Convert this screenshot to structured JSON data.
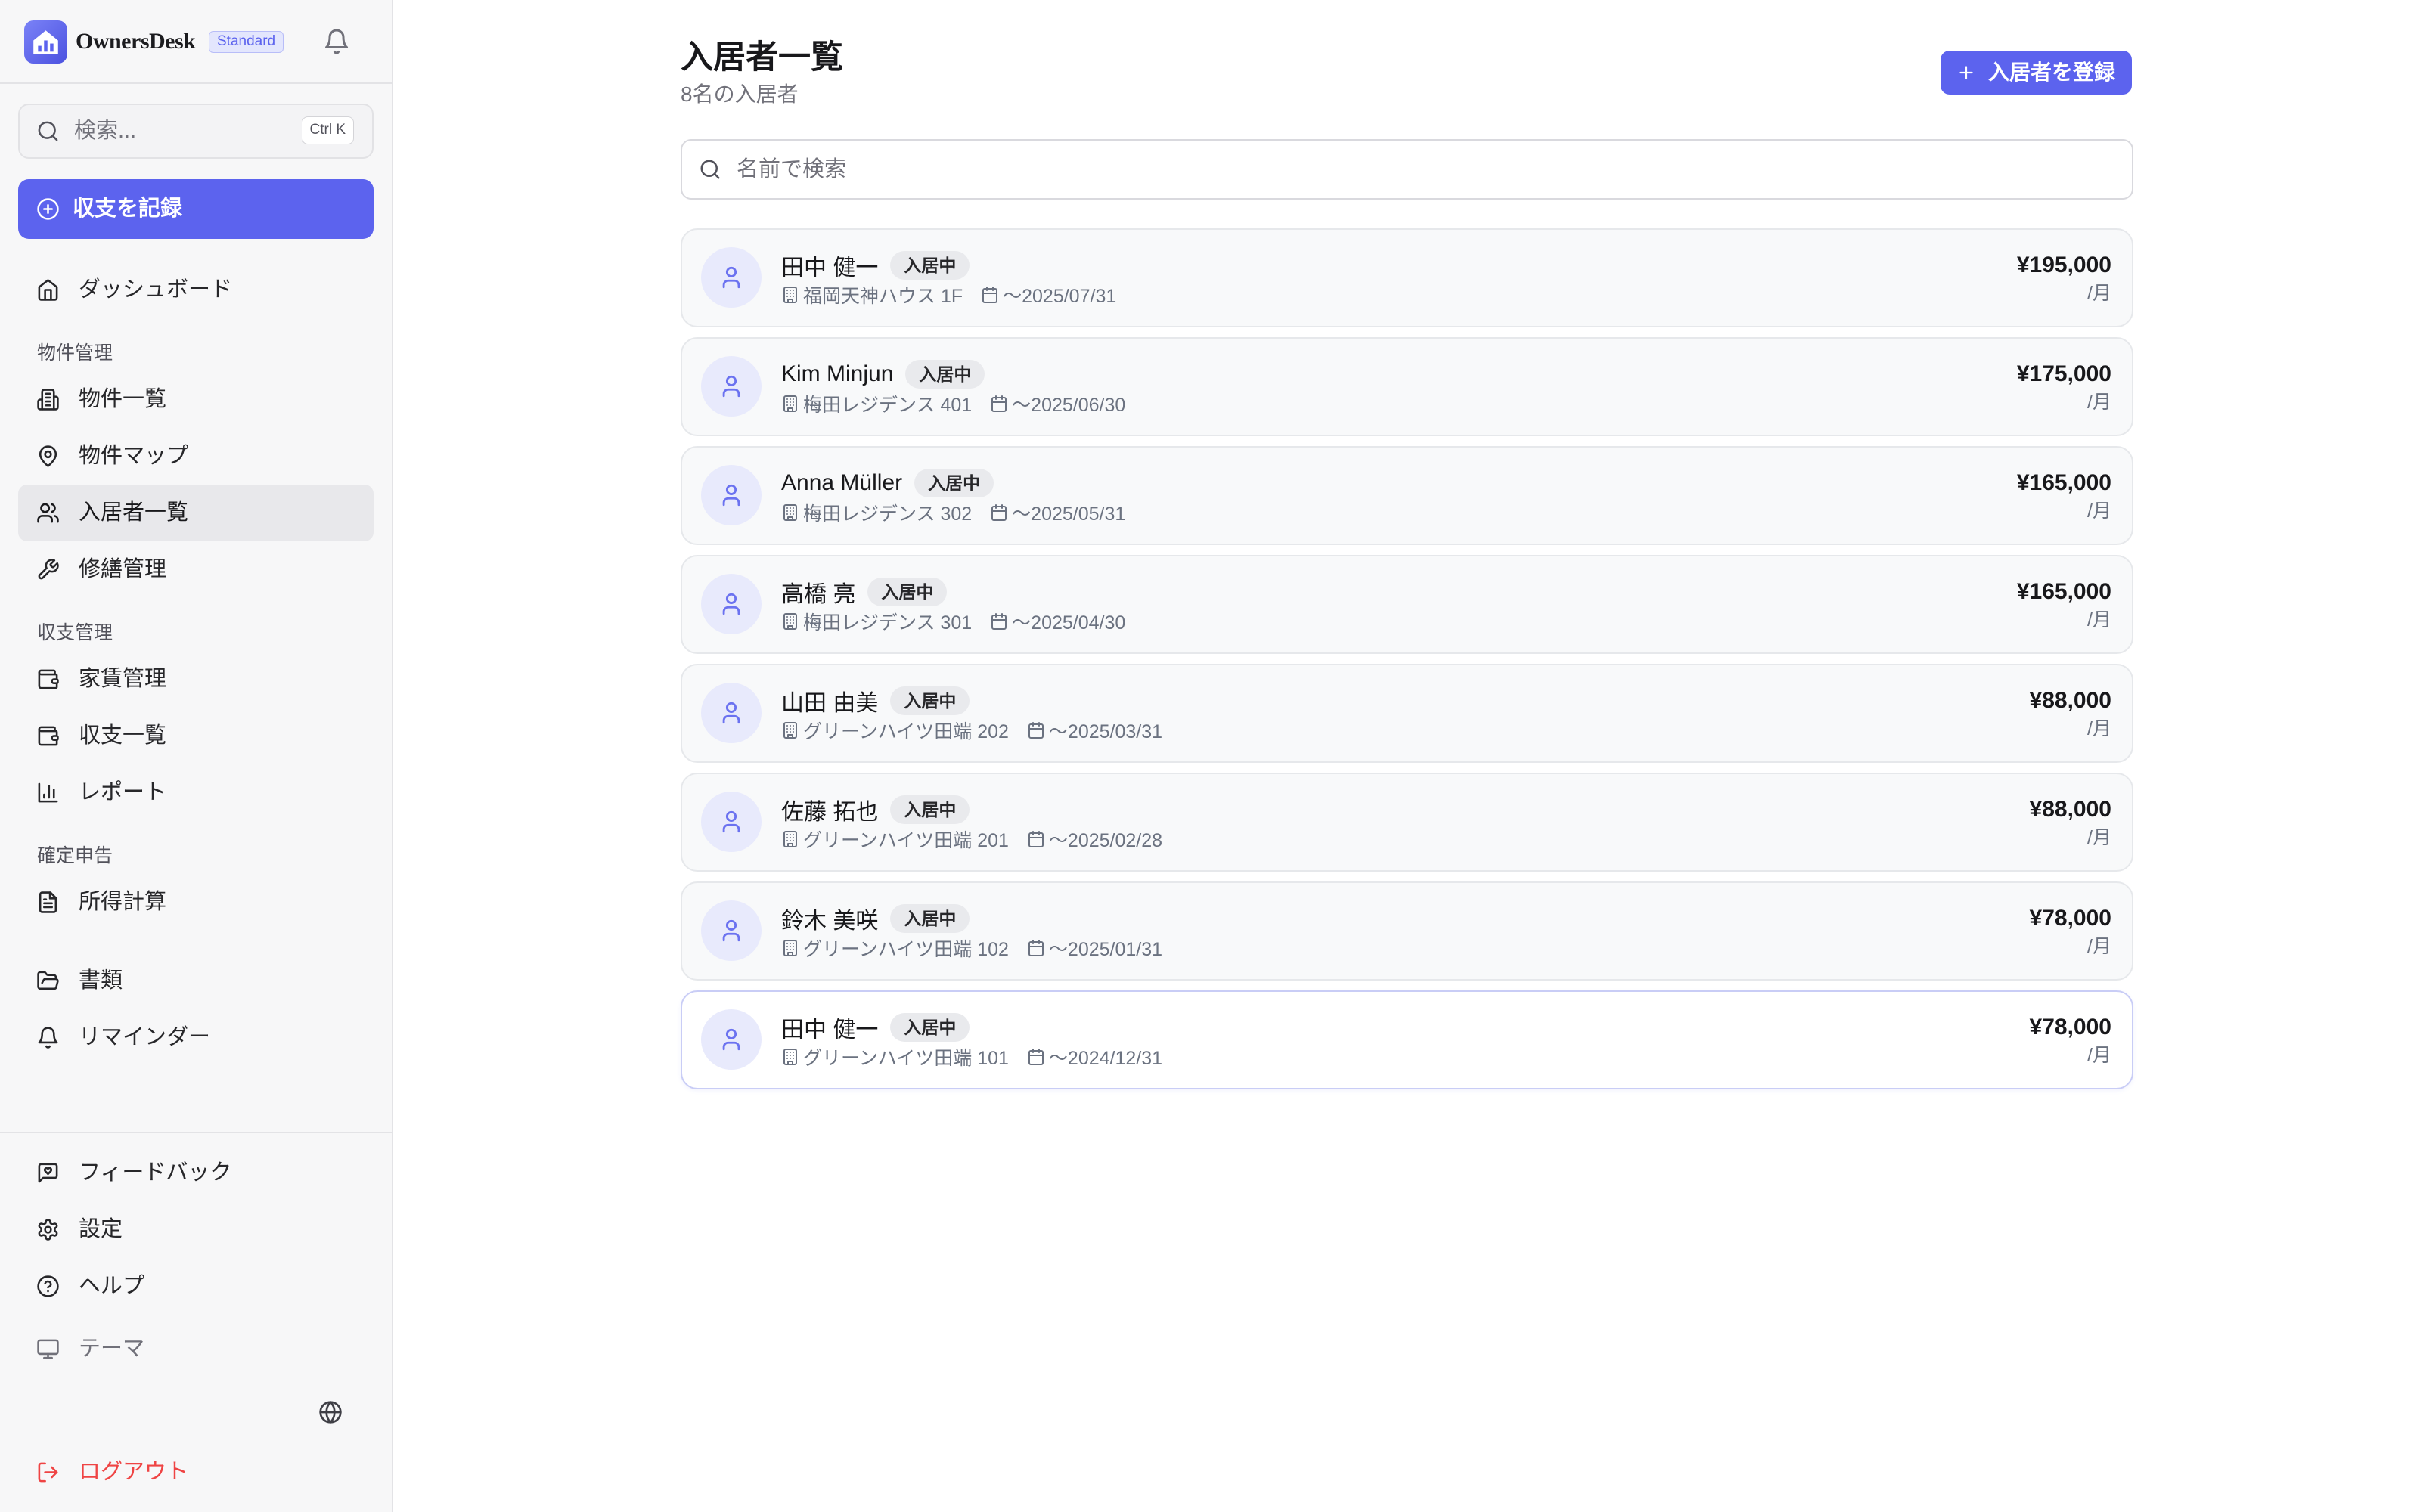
{
  "app": {
    "name": "OwnersDesk",
    "plan": "Standard"
  },
  "colors": {
    "accent": "#5c63ee",
    "danger": "#ef4444",
    "active_item_bg": "#e8e8eb"
  },
  "sidebar": {
    "search": {
      "placeholder": "検索...",
      "shortcut": "Ctrl K",
      "icon": "search-icon"
    },
    "record_button": {
      "label": "収支を記録",
      "icon": "plus-circle-icon"
    },
    "dashboard": {
      "label": "ダッシュボード",
      "icon": "home-icon"
    },
    "sections": [
      {
        "label": "物件管理",
        "items": [
          {
            "label": "物件一覧",
            "icon": "building-icon"
          },
          {
            "label": "物件マップ",
            "icon": "map-pin-icon"
          },
          {
            "label": "入居者一覧",
            "icon": "users-icon",
            "active": true
          },
          {
            "label": "修繕管理",
            "icon": "wrench-icon"
          }
        ]
      },
      {
        "label": "収支管理",
        "items": [
          {
            "label": "家賃管理",
            "icon": "wallet-icon"
          },
          {
            "label": "収支一覧",
            "icon": "wallet-icon"
          },
          {
            "label": "レポート",
            "icon": "bar-chart-icon"
          }
        ]
      },
      {
        "label": "確定申告",
        "items": [
          {
            "label": "所得計算",
            "icon": "file-text-icon"
          }
        ]
      }
    ],
    "extra_items": [
      {
        "label": "書類",
        "icon": "folder-open-icon"
      },
      {
        "label": "リマインダー",
        "icon": "bell-icon"
      }
    ],
    "footer_items": [
      {
        "label": "フィードバック",
        "icon": "message-heart-icon"
      },
      {
        "label": "設定",
        "icon": "gear-icon"
      },
      {
        "label": "ヘルプ",
        "icon": "help-circle-icon"
      },
      {
        "label": "テーマ",
        "icon": "monitor-icon"
      }
    ],
    "language_icon": "globe-icon",
    "logout": {
      "label": "ログアウト",
      "icon": "log-out-icon"
    }
  },
  "main": {
    "title": "入居者一覧",
    "subtitle": "8名の入居者",
    "add_button": {
      "label": "入居者を登録",
      "icon": "plus-icon"
    },
    "search_placeholder": "名前で検索",
    "tenants": [
      {
        "name": "田中 健一",
        "status": "入居中",
        "property": "福岡天神ハウス 1F",
        "lease_end": "〜2025/07/31",
        "rent": "¥195,000",
        "rent_unit": "/月"
      },
      {
        "name": "Kim Minjun",
        "status": "入居中",
        "property": "梅田レジデンス 401",
        "lease_end": "〜2025/06/30",
        "rent": "¥175,000",
        "rent_unit": "/月"
      },
      {
        "name": "Anna Müller",
        "status": "入居中",
        "property": "梅田レジデンス 302",
        "lease_end": "〜2025/05/31",
        "rent": "¥165,000",
        "rent_unit": "/月"
      },
      {
        "name": "高橋 亮",
        "status": "入居中",
        "property": "梅田レジデンス 301",
        "lease_end": "〜2025/04/30",
        "rent": "¥165,000",
        "rent_unit": "/月"
      },
      {
        "name": "山田 由美",
        "status": "入居中",
        "property": "グリーンハイツ田端 202",
        "lease_end": "〜2025/03/31",
        "rent": "¥88,000",
        "rent_unit": "/月"
      },
      {
        "name": "佐藤 拓也",
        "status": "入居中",
        "property": "グリーンハイツ田端 201",
        "lease_end": "〜2025/02/28",
        "rent": "¥88,000",
        "rent_unit": "/月"
      },
      {
        "name": "鈴木 美咲",
        "status": "入居中",
        "property": "グリーンハイツ田端 102",
        "lease_end": "〜2025/01/31",
        "rent": "¥78,000",
        "rent_unit": "/月"
      },
      {
        "name": "田中 健一",
        "status": "入居中",
        "property": "グリーンハイツ田端 101",
        "lease_end": "〜2024/12/31",
        "rent": "¥78,000",
        "rent_unit": "/月"
      }
    ]
  }
}
